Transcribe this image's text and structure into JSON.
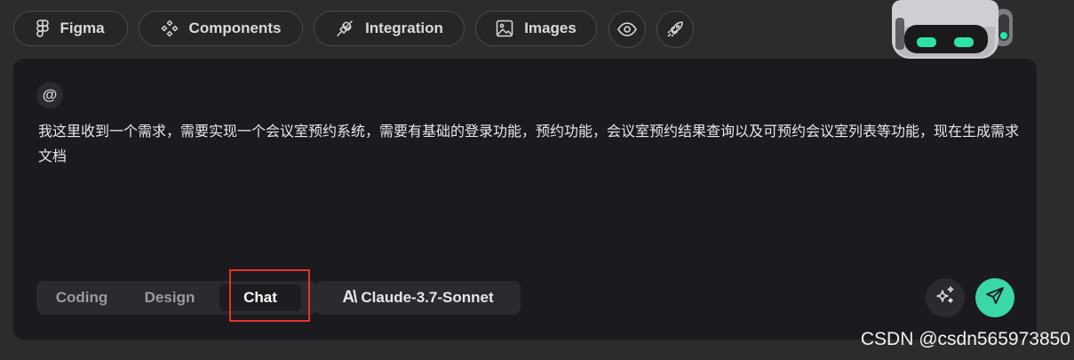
{
  "toolbar": {
    "items": [
      {
        "label": "Figma",
        "icon": "figma-icon"
      },
      {
        "label": "Components",
        "icon": "components-icon"
      },
      {
        "label": "Integration",
        "icon": "plug-icon"
      },
      {
        "label": "Images",
        "icon": "image-icon"
      }
    ],
    "preview_icon": "eye-icon",
    "deploy_icon": "rocket-icon"
  },
  "composer": {
    "mention_symbol": "@",
    "prompt_text": "我这里收到一个需求，需要实现一个会议室预约系统，需要有基础的登录功能，预约功能，会议室预约结果查询以及可预约会议室列表等功能，现在生成需求文档",
    "modes": [
      "Coding",
      "Design",
      "Chat"
    ],
    "active_mode": "Chat",
    "model_label": "Claude-3.7-Sonnet",
    "model_logo": "A\\"
  },
  "colors": {
    "send_button": "#3ad7a9",
    "highlight_box": "#e8322b",
    "robot_eyes": "#2de3a6"
  },
  "watermark": "CSDN @csdn565973850"
}
